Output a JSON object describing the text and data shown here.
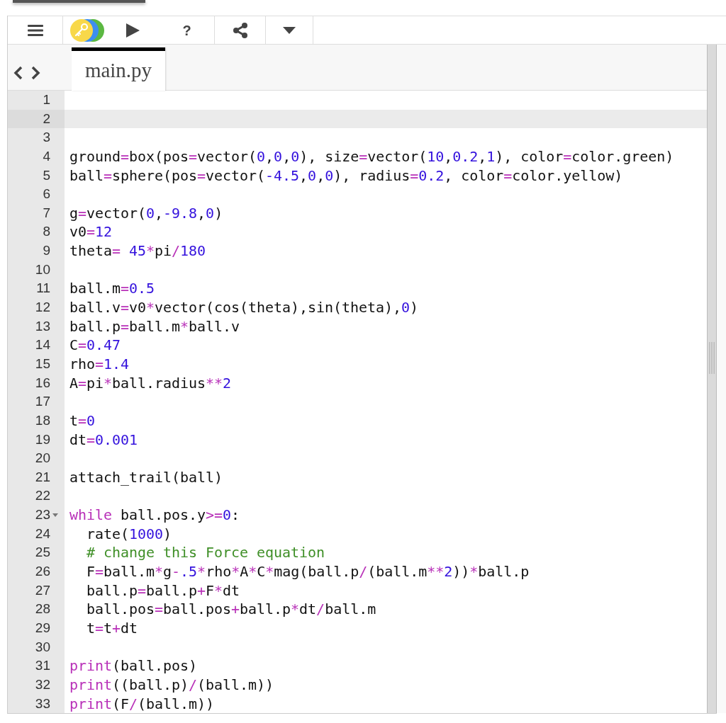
{
  "toolbar": {
    "buttons": [
      {
        "kind": "menu"
      },
      {
        "kind": "logo"
      },
      {
        "kind": "run"
      },
      {
        "kind": "help",
        "label": "?"
      },
      {
        "kind": "share"
      },
      {
        "kind": "dropdown"
      }
    ]
  },
  "tabs": [
    {
      "label": "main.py",
      "selected": true
    }
  ],
  "editor": {
    "lines": [
      {
        "number": "1",
        "active": false
      },
      {
        "number": "2",
        "active": true
      },
      {
        "number": "3",
        "active": false
      },
      {
        "number": "4",
        "active": false,
        "tokens": [
          {
            "kind": "text",
            "text": "ground"
          },
          {
            "kind": "op",
            "text": "="
          },
          {
            "kind": "text",
            "text": "box(pos"
          },
          {
            "kind": "op",
            "text": "="
          },
          {
            "kind": "text",
            "text": "vector("
          },
          {
            "kind": "num",
            "text": "0"
          },
          {
            "kind": "text",
            "text": ","
          },
          {
            "kind": "num",
            "text": "0"
          },
          {
            "kind": "text",
            "text": ","
          },
          {
            "kind": "num",
            "text": "0"
          },
          {
            "kind": "text",
            "text": "), size"
          },
          {
            "kind": "op",
            "text": "="
          },
          {
            "kind": "text",
            "text": "vector("
          },
          {
            "kind": "num",
            "text": "10"
          },
          {
            "kind": "text",
            "text": ","
          },
          {
            "kind": "num",
            "text": "0.2"
          },
          {
            "kind": "text",
            "text": ","
          },
          {
            "kind": "num",
            "text": "1"
          },
          {
            "kind": "text",
            "text": "), color"
          },
          {
            "kind": "op",
            "text": "="
          },
          {
            "kind": "text",
            "text": "color.green)"
          }
        ]
      },
      {
        "number": "5",
        "active": false,
        "tokens": [
          {
            "kind": "text",
            "text": "ball"
          },
          {
            "kind": "op",
            "text": "="
          },
          {
            "kind": "text",
            "text": "sphere(pos"
          },
          {
            "kind": "op",
            "text": "="
          },
          {
            "kind": "text",
            "text": "vector("
          },
          {
            "kind": "num",
            "text": "-4.5"
          },
          {
            "kind": "text",
            "text": ","
          },
          {
            "kind": "num",
            "text": "0"
          },
          {
            "kind": "text",
            "text": ","
          },
          {
            "kind": "num",
            "text": "0"
          },
          {
            "kind": "text",
            "text": "), radius"
          },
          {
            "kind": "op",
            "text": "="
          },
          {
            "kind": "num",
            "text": "0.2"
          },
          {
            "kind": "text",
            "text": ", color"
          },
          {
            "kind": "op",
            "text": "="
          },
          {
            "kind": "text",
            "text": "color.yellow)"
          }
        ]
      },
      {
        "number": "6",
        "active": false
      },
      {
        "number": "7",
        "active": false,
        "tokens": [
          {
            "kind": "text",
            "text": "g"
          },
          {
            "kind": "op",
            "text": "="
          },
          {
            "kind": "text",
            "text": "vector("
          },
          {
            "kind": "num",
            "text": "0"
          },
          {
            "kind": "text",
            "text": ","
          },
          {
            "kind": "num",
            "text": "-9.8"
          },
          {
            "kind": "text",
            "text": ","
          },
          {
            "kind": "num",
            "text": "0"
          },
          {
            "kind": "text",
            "text": ")"
          }
        ]
      },
      {
        "number": "8",
        "active": false,
        "tokens": [
          {
            "kind": "text",
            "text": "v0"
          },
          {
            "kind": "op",
            "text": "="
          },
          {
            "kind": "num",
            "text": "12"
          }
        ]
      },
      {
        "number": "9",
        "active": false,
        "tokens": [
          {
            "kind": "text",
            "text": "theta"
          },
          {
            "kind": "op",
            "text": "= "
          },
          {
            "kind": "num",
            "text": "45"
          },
          {
            "kind": "op",
            "text": "*"
          },
          {
            "kind": "text",
            "text": "pi"
          },
          {
            "kind": "op",
            "text": "/"
          },
          {
            "kind": "num",
            "text": "180"
          }
        ]
      },
      {
        "number": "10",
        "active": false
      },
      {
        "number": "11",
        "active": false,
        "tokens": [
          {
            "kind": "text",
            "text": "ball.m"
          },
          {
            "kind": "op",
            "text": "="
          },
          {
            "kind": "num",
            "text": "0.5"
          }
        ]
      },
      {
        "number": "12",
        "active": false,
        "tokens": [
          {
            "kind": "text",
            "text": "ball.v"
          },
          {
            "kind": "op",
            "text": "="
          },
          {
            "kind": "text",
            "text": "v0"
          },
          {
            "kind": "op",
            "text": "*"
          },
          {
            "kind": "text",
            "text": "vector(cos(theta),sin(theta),"
          },
          {
            "kind": "num",
            "text": "0"
          },
          {
            "kind": "text",
            "text": ")"
          }
        ]
      },
      {
        "number": "13",
        "active": false,
        "tokens": [
          {
            "kind": "text",
            "text": "ball.p"
          },
          {
            "kind": "op",
            "text": "="
          },
          {
            "kind": "text",
            "text": "ball.m"
          },
          {
            "kind": "op",
            "text": "*"
          },
          {
            "kind": "text",
            "text": "ball.v"
          }
        ]
      },
      {
        "number": "14",
        "active": false,
        "tokens": [
          {
            "kind": "text",
            "text": "C"
          },
          {
            "kind": "op",
            "text": "="
          },
          {
            "kind": "num",
            "text": "0.47"
          }
        ]
      },
      {
        "number": "15",
        "active": false,
        "tokens": [
          {
            "kind": "text",
            "text": "rho"
          },
          {
            "kind": "op",
            "text": "="
          },
          {
            "kind": "num",
            "text": "1.4"
          }
        ]
      },
      {
        "number": "16",
        "active": false,
        "tokens": [
          {
            "kind": "text",
            "text": "A"
          },
          {
            "kind": "op",
            "text": "="
          },
          {
            "kind": "text",
            "text": "pi"
          },
          {
            "kind": "op",
            "text": "*"
          },
          {
            "kind": "text",
            "text": "ball.radius"
          },
          {
            "kind": "op",
            "text": "**"
          },
          {
            "kind": "num",
            "text": "2"
          }
        ]
      },
      {
        "number": "17",
        "active": false
      },
      {
        "number": "18",
        "active": false,
        "tokens": [
          {
            "kind": "text",
            "text": "t"
          },
          {
            "kind": "op",
            "text": "="
          },
          {
            "kind": "num",
            "text": "0"
          }
        ]
      },
      {
        "number": "19",
        "active": false,
        "tokens": [
          {
            "kind": "text",
            "text": "dt"
          },
          {
            "kind": "op",
            "text": "="
          },
          {
            "kind": "num",
            "text": "0.001"
          }
        ]
      },
      {
        "number": "20",
        "active": false
      },
      {
        "number": "21",
        "active": false,
        "tokens": [
          {
            "kind": "text",
            "text": "attach_trail(ball)"
          }
        ]
      },
      {
        "number": "22",
        "active": false
      },
      {
        "number": "23",
        "active": false,
        "expanded": true,
        "tokens": [
          {
            "kind": "keyword",
            "text": "while"
          },
          {
            "kind": "text",
            "text": " ball.pos.y"
          },
          {
            "kind": "op",
            "text": ">="
          },
          {
            "kind": "num",
            "text": "0"
          },
          {
            "kind": "text",
            "text": ":"
          }
        ],
        "children": [
          {
            "number": "24",
            "active": false,
            "tokens": [
              {
                "kind": "text",
                "text": "rate("
              },
              {
                "kind": "num",
                "text": "1000"
              },
              {
                "kind": "text",
                "text": ")"
              }
            ]
          },
          {
            "number": "25",
            "active": false,
            "tokens": [
              {
                "kind": "comment",
                "text": "# change this Force equation"
              }
            ]
          },
          {
            "number": "26",
            "active": false,
            "tokens": [
              {
                "kind": "text",
                "text": "F"
              },
              {
                "kind": "op",
                "text": "="
              },
              {
                "kind": "text",
                "text": "ball.m"
              },
              {
                "kind": "op",
                "text": "*"
              },
              {
                "kind": "text",
                "text": "g"
              },
              {
                "kind": "op",
                "text": "-"
              },
              {
                "kind": "num",
                "text": ".5"
              },
              {
                "kind": "op",
                "text": "*"
              },
              {
                "kind": "text",
                "text": "rho"
              },
              {
                "kind": "op",
                "text": "*"
              },
              {
                "kind": "text",
                "text": "A"
              },
              {
                "kind": "op",
                "text": "*"
              },
              {
                "kind": "text",
                "text": "C"
              },
              {
                "kind": "op",
                "text": "*"
              },
              {
                "kind": "text",
                "text": "mag(ball.p"
              },
              {
                "kind": "op",
                "text": "/"
              },
              {
                "kind": "text",
                "text": "(ball.m"
              },
              {
                "kind": "op",
                "text": "**"
              },
              {
                "kind": "num",
                "text": "2"
              },
              {
                "kind": "text",
                "text": "))"
              },
              {
                "kind": "op",
                "text": "*"
              },
              {
                "kind": "text",
                "text": "ball.p"
              }
            ]
          },
          {
            "number": "27",
            "active": false,
            "tokens": [
              {
                "kind": "text",
                "text": "ball.p"
              },
              {
                "kind": "op",
                "text": "="
              },
              {
                "kind": "text",
                "text": "ball.p"
              },
              {
                "kind": "op",
                "text": "+"
              },
              {
                "kind": "text",
                "text": "F"
              },
              {
                "kind": "op",
                "text": "*"
              },
              {
                "kind": "text",
                "text": "dt"
              }
            ]
          },
          {
            "number": "28",
            "active": false,
            "tokens": [
              {
                "kind": "text",
                "text": "ball.pos"
              },
              {
                "kind": "op",
                "text": "="
              },
              {
                "kind": "text",
                "text": "ball.pos"
              },
              {
                "kind": "op",
                "text": "+"
              },
              {
                "kind": "text",
                "text": "ball.p"
              },
              {
                "kind": "op",
                "text": "*"
              },
              {
                "kind": "text",
                "text": "dt"
              },
              {
                "kind": "op",
                "text": "/"
              },
              {
                "kind": "text",
                "text": "ball.m"
              }
            ]
          },
          {
            "number": "29",
            "active": false,
            "tokens": [
              {
                "kind": "text",
                "text": "t"
              },
              {
                "kind": "op",
                "text": "="
              },
              {
                "kind": "text",
                "text": "t"
              },
              {
                "kind": "op",
                "text": "+"
              },
              {
                "kind": "text",
                "text": "dt"
              }
            ]
          }
        ]
      },
      {
        "number": "30",
        "active": false
      },
      {
        "number": "31",
        "active": false,
        "tokens": [
          {
            "kind": "keyword",
            "text": "print"
          },
          {
            "kind": "text",
            "text": "(ball.pos)"
          }
        ]
      },
      {
        "number": "32",
        "active": false,
        "tokens": [
          {
            "kind": "keyword",
            "text": "print"
          },
          {
            "kind": "text",
            "text": "((ball.p)"
          },
          {
            "kind": "op",
            "text": "/"
          },
          {
            "kind": "text",
            "text": "(ball.m))"
          }
        ]
      },
      {
        "number": "33",
        "active": false,
        "tokens": [
          {
            "kind": "keyword",
            "text": "print"
          },
          {
            "kind": "text",
            "text": "(F"
          },
          {
            "kind": "op",
            "text": "/"
          },
          {
            "kind": "text",
            "text": "(ball.m))"
          }
        ]
      }
    ]
  }
}
